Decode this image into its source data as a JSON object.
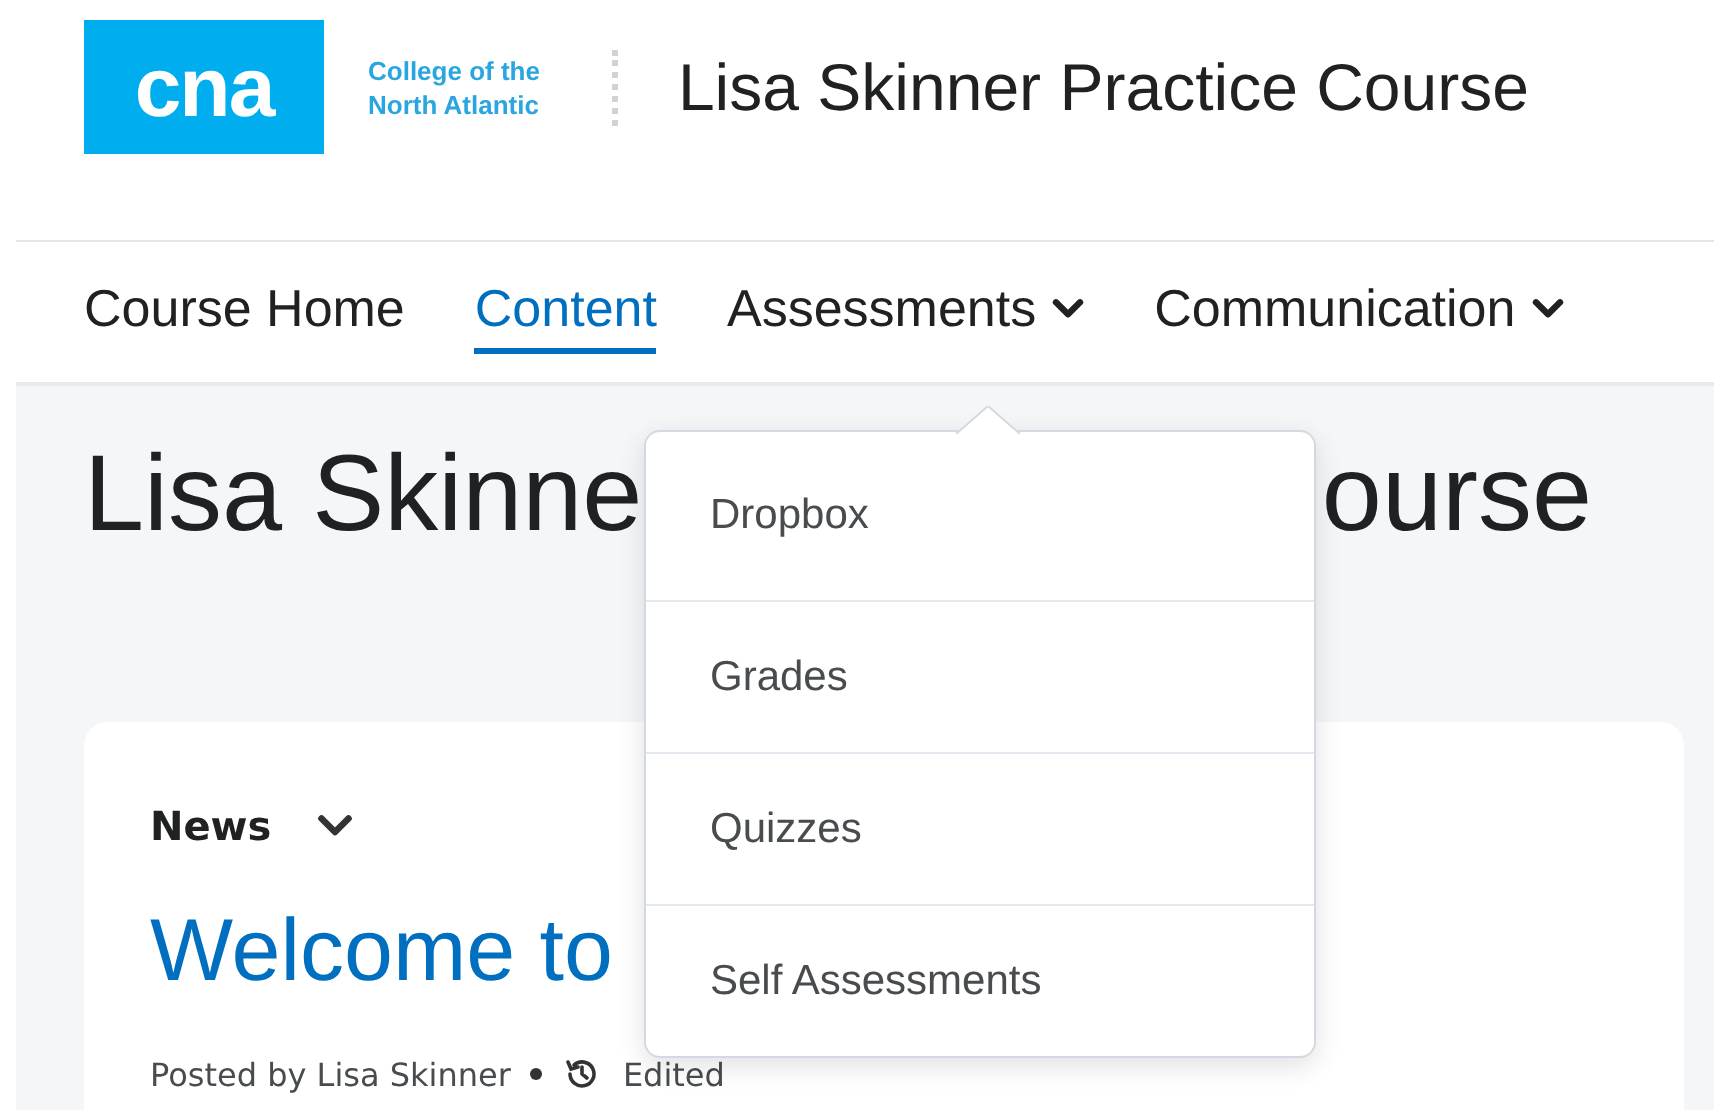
{
  "header": {
    "logo": "cna",
    "college_name": [
      "College of the",
      "North Atlantic"
    ],
    "course_title": "Lisa Skinner Practice Course"
  },
  "nav": [
    {
      "label": "Course Home",
      "selected": false,
      "kind": "link"
    },
    {
      "label": "Content",
      "selected": true,
      "kind": "link"
    },
    {
      "label": "Assessments",
      "selected": false,
      "kind": "menu"
    },
    {
      "label": "Communication",
      "selected": false,
      "kind": "menu"
    }
  ],
  "dropdown": {
    "items": [
      "Dropbox",
      "Grades",
      "Quizzes",
      "Self Assessments"
    ]
  },
  "page_heading": [
    "Lisa Skinne",
    "ourse"
  ],
  "news": {
    "title": "News",
    "headline": "Welcome to",
    "posted_by": "Posted by Lisa Skinner",
    "edited": "Edited"
  }
}
